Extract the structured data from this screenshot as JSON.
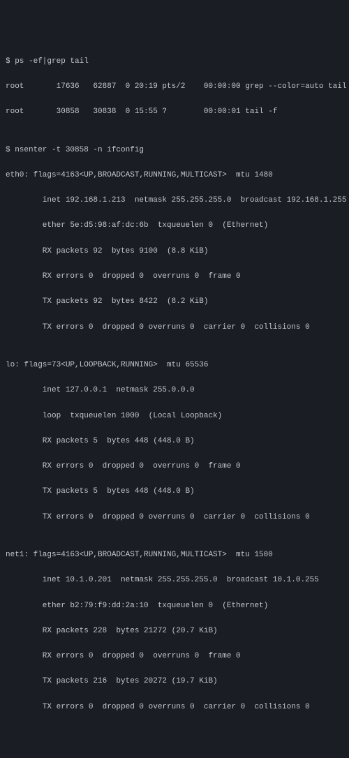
{
  "lines": {
    "l01": "$ ps -ef|grep tail",
    "l02": "root       17636   62887  0 20:19 pts/2    00:00:00 grep --color=auto tail",
    "l03": "root       30858   30838  0 15:55 ?        00:00:01 tail -f",
    "l04": "",
    "l05": "$ nsenter -t 30858 -n ifconfig",
    "l06": "eth0: flags=4163<UP,BROADCAST,RUNNING,MULTICAST>  mtu 1480",
    "l07": "        inet 192.168.1.213  netmask 255.255.255.0  broadcast 192.168.1.255",
    "l08": "        ether 5e:d5:98:af:dc:6b  txqueuelen 0  (Ethernet)",
    "l09": "        RX packets 92  bytes 9100  (8.8 KiB)",
    "l10": "        RX errors 0  dropped 0  overruns 0  frame 0",
    "l11": "        TX packets 92  bytes 8422  (8.2 KiB)",
    "l12": "        TX errors 0  dropped 0 overruns 0  carrier 0  collisions 0",
    "l13": "",
    "l14": "lo: flags=73<UP,LOOPBACK,RUNNING>  mtu 65536",
    "l15": "        inet 127.0.0.1  netmask 255.0.0.0",
    "l16": "        loop  txqueuelen 1000  (Local Loopback)",
    "l17": "        RX packets 5  bytes 448 (448.0 B)",
    "l18": "        RX errors 0  dropped 0  overruns 0  frame 0",
    "l19": "        TX packets 5  bytes 448 (448.0 B)",
    "l20": "        TX errors 0  dropped 0 overruns 0  carrier 0  collisions 0",
    "l21": "",
    "l22": "net1: flags=4163<UP,BROADCAST,RUNNING,MULTICAST>  mtu 1500",
    "l23": "        inet 10.1.0.201  netmask 255.255.255.0  broadcast 10.1.0.255",
    "l24": "        ether b2:79:f9:dd:2a:10  txqueuelen 0  (Ethernet)",
    "l25": "        RX packets 228  bytes 21272 (20.7 KiB)",
    "l26": "        RX errors 0  dropped 0  overruns 0  frame 0",
    "l27": "        TX packets 216  bytes 20272 (19.7 KiB)",
    "l28": "        TX errors 0  dropped 0 overruns 0  carrier 0  collisions 0"
  }
}
